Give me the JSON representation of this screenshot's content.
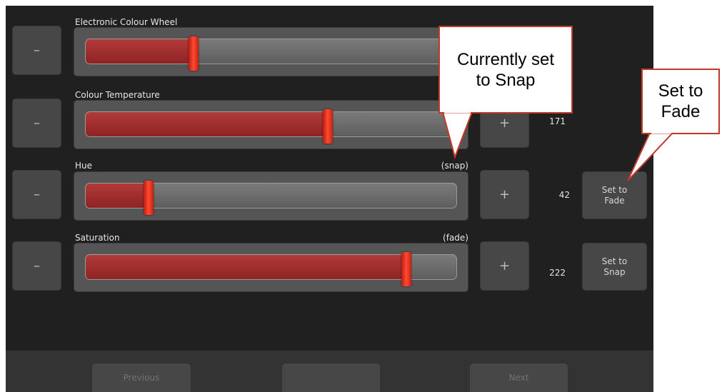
{
  "sliders": [
    {
      "label": "Electronic Colour Wheel",
      "mode": "",
      "value": "",
      "level_percent": 29
    },
    {
      "label": "Colour Temperature",
      "mode": "",
      "value": "171",
      "level_percent": 65
    },
    {
      "label": "Hue",
      "mode": "(snap)",
      "value": "42",
      "level_percent": 17,
      "set_button": "Set to\nFade"
    },
    {
      "label": "Saturation",
      "mode": "(fade)",
      "value": "222",
      "level_percent": 86,
      "set_button": "Set to\nSnap"
    }
  ],
  "decrement_label": "–",
  "increment_label": "+",
  "nav": {
    "previous": "Previous",
    "middle": "",
    "next": "Next"
  },
  "callouts": {
    "current": "Currently set to Snap",
    "set": "Set to Fade"
  },
  "colors": {
    "background": "#202020",
    "fill": "#a63030",
    "thumb": "#e8311f",
    "callout_border": "#c0392b"
  }
}
